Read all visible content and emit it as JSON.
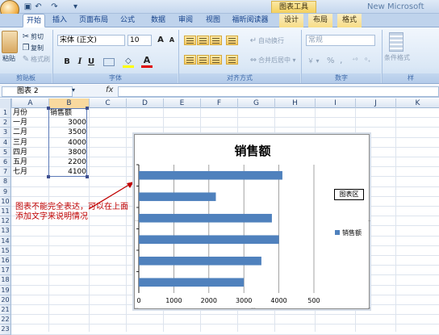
{
  "title_bar": {
    "quick_access": [
      "save-icon",
      "undo-icon",
      "redo-icon",
      "customize-icon"
    ],
    "context_tab_group": "图表工具",
    "app_title": "New Microsoft"
  },
  "tabs": [
    {
      "label": "开始",
      "active": true
    },
    {
      "label": "插入"
    },
    {
      "label": "页面布局"
    },
    {
      "label": "公式"
    },
    {
      "label": "数据"
    },
    {
      "label": "审阅"
    },
    {
      "label": "视图"
    },
    {
      "label": "福昕阅读器"
    },
    {
      "label": "设计",
      "contextual": true
    },
    {
      "label": "布局",
      "contextual": true
    },
    {
      "label": "格式",
      "contextual": true
    }
  ],
  "ribbon": {
    "clipboard": {
      "paste": "粘贴",
      "cut": "剪切",
      "copy": "复制",
      "format_painter": "格式刷",
      "label": "剪贴板"
    },
    "font": {
      "name": "宋体 (正文)",
      "size": "10",
      "grow": "A",
      "shrink": "A",
      "bold": "B",
      "italic": "I",
      "underline": "U",
      "label": "字体"
    },
    "alignment": {
      "wrap": "自动换行",
      "merge": "合并后居中",
      "label": "对齐方式"
    },
    "number": {
      "format": "常规",
      "percent": "%",
      "comma": ",",
      "label": "数字"
    },
    "styles": {
      "conditional": "条件格式",
      "label": "样"
    }
  },
  "formula_bar": {
    "name_box": "图表 2",
    "fx": "fx",
    "content": ""
  },
  "columns": [
    "A",
    "B",
    "C",
    "D",
    "E",
    "F",
    "G",
    "H",
    "I",
    "J",
    "K"
  ],
  "rows": [
    "1",
    "2",
    "3",
    "4",
    "5",
    "6",
    "7",
    "8",
    "9",
    "10",
    "11",
    "12",
    "13",
    "14",
    "15",
    "16",
    "17",
    "18",
    "19",
    "20",
    "21",
    "22",
    "23"
  ],
  "sheet": {
    "headers": [
      "月份",
      "销售额"
    ],
    "data": [
      {
        "month": "一月",
        "value": "3000"
      },
      {
        "month": "二月",
        "value": "3500"
      },
      {
        "month": "三月",
        "value": "4000"
      },
      {
        "month": "四月",
        "value": "3800"
      },
      {
        "month": "五月",
        "value": "2200"
      },
      {
        "month": "七月",
        "value": "4100"
      }
    ]
  },
  "chart_data": {
    "type": "bar",
    "orientation": "horizontal",
    "title": "销售额",
    "categories": [
      "一月",
      "二月",
      "三月",
      "四月",
      "五月",
      "七月"
    ],
    "series": [
      {
        "name": "销售额",
        "values": [
          3000,
          3500,
          4000,
          3800,
          2200,
          4100
        ],
        "color": "#4f81bd"
      }
    ],
    "xlim": [
      0,
      5000
    ],
    "xticks": [
      "0",
      "1000",
      "2000",
      "3000",
      "4000",
      "500"
    ],
    "grid": true,
    "legend_position": "right"
  },
  "chart_area_tip": "图表区",
  "annotation": "图表不能完全表达，可以在上面添加文字来说明情况"
}
